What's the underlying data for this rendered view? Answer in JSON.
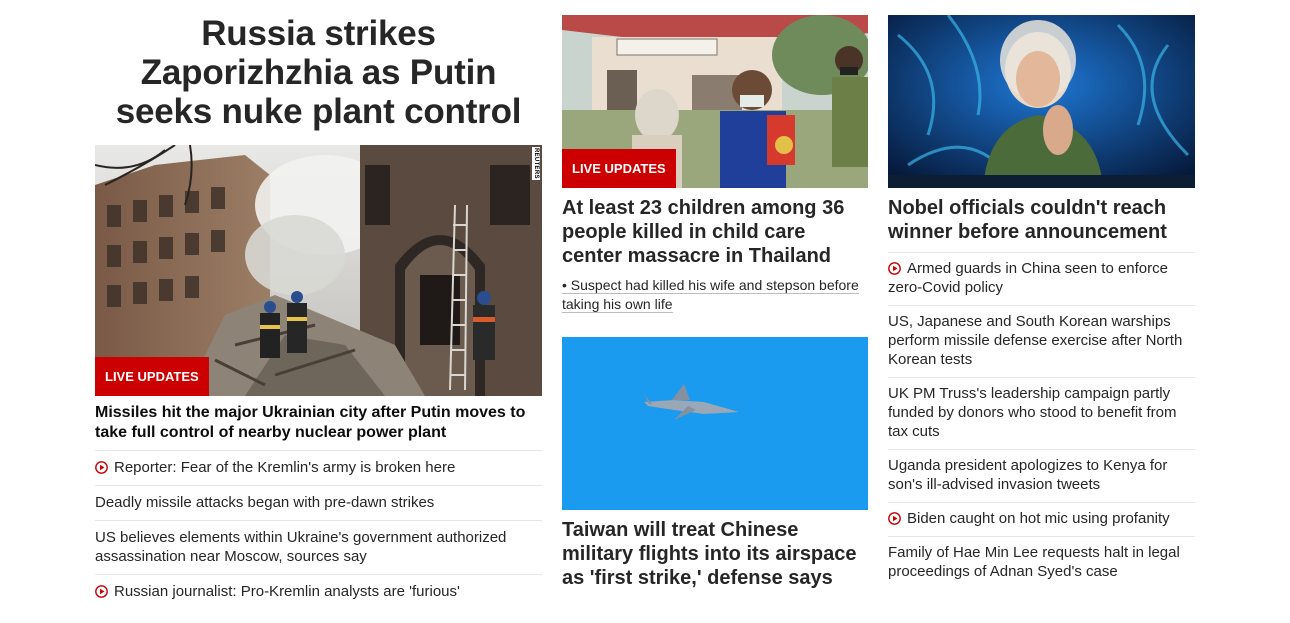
{
  "col1": {
    "headline": "Russia strikes Zaporizhzhia as Putin seeks nuke plant control",
    "badge": "LIVE UPDATES",
    "photo_credit": "REUTERS",
    "lead": "Missiles hit the major Ukrainian city after Putin moves to take full control of nearby nuclear power plant",
    "items": [
      {
        "text": "Reporter: Fear of the Kremlin's army is broken here",
        "video": true
      },
      {
        "text": "Deadly missile attacks began with pre-dawn strikes",
        "video": false
      },
      {
        "text": "US believes elements within Ukraine's government authorized assassination near Moscow, sources say",
        "video": false
      },
      {
        "text": "Russian journalist: Pro-Kremlin analysts are 'furious'",
        "video": true
      }
    ]
  },
  "col2": {
    "badge": "LIVE UPDATES",
    "story1": {
      "title": "At least 23 children among 36 people killed in child care center massacre in Thailand",
      "bullet": "• Suspect had killed his wife and stepson before taking his own life"
    },
    "story2": {
      "title": "Taiwan will treat Chinese military flights into its airspace as 'first strike,' defense says"
    }
  },
  "col3": {
    "lead": "Nobel officials couldn't reach winner before announcement",
    "items": [
      {
        "text": "Armed guards in China seen to enforce zero-Covid policy",
        "video": true
      },
      {
        "text": "US, Japanese and South Korean warships perform missile defense exercise after North Korean tests",
        "video": false
      },
      {
        "text": "UK PM Truss's leadership campaign partly funded by donors who stood to benefit from tax cuts",
        "video": false
      },
      {
        "text": "Uganda president apologizes to Kenya for son's ill-advised invasion tweets",
        "video": false
      },
      {
        "text": "Biden caught on hot mic using profanity",
        "video": true
      },
      {
        "text": "Family of Hae Min Lee requests halt in legal proceedings of Adnan Syed's case",
        "video": false
      }
    ]
  },
  "colors": {
    "accent": "#cc0000",
    "text": "#262626",
    "divider": "#e6e6e6"
  }
}
